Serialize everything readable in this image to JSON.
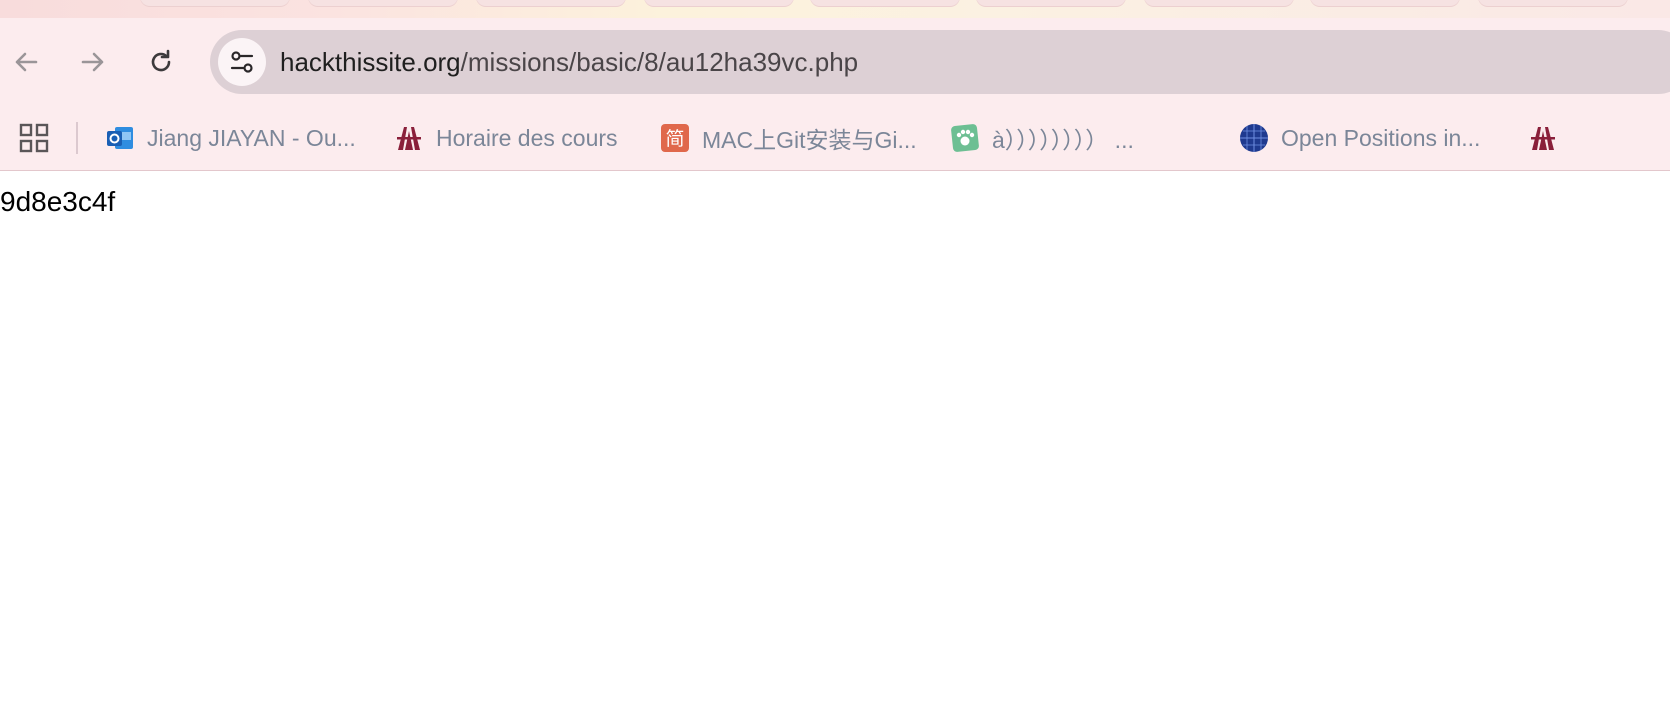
{
  "browser": {
    "url_host": "hackthissite.org",
    "url_path": "/missions/basic/8/au12ha39vc.php",
    "nav_icons": [
      "back-arrow-icon",
      "forward-arrow-icon",
      "reload-icon",
      "site-info-icon"
    ]
  },
  "bookmarks": [
    {
      "label": "Jiang JIAYAN - Ou...",
      "icon": "outlook-icon"
    },
    {
      "label": "Horaire des cours",
      "icon": "university-logo-icon"
    },
    {
      "label": "MAC上Git安装与Gi...",
      "icon": "jianshu-icon"
    },
    {
      "label": "à）））））））） ...",
      "icon": "paw-icon"
    },
    {
      "label": "Open Positions in...",
      "icon": "globe-grid-icon"
    }
  ],
  "page": {
    "text": "9d8e3c4f"
  },
  "colors": {
    "chrome_bg": "#fcecee",
    "omnibox_bg": "#ddd0d5",
    "bookmark_text": "#7b8698"
  }
}
